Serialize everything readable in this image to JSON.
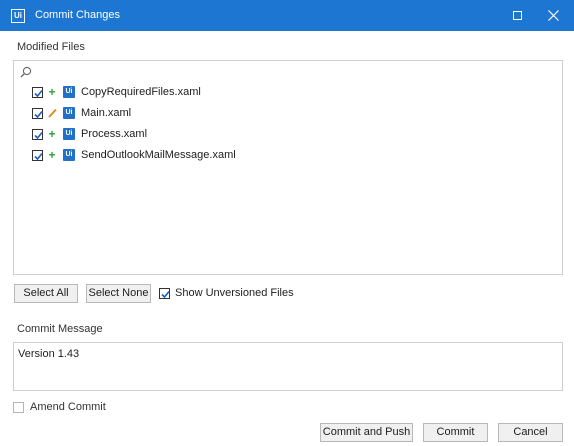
{
  "window": {
    "app_icon": "Ui",
    "title": "Commit Changes"
  },
  "modified_files": {
    "label": "Modified Files",
    "search_icon": "search-icon",
    "items": [
      {
        "checked": true,
        "status": "added",
        "status_glyph": "+",
        "badge": "Ui",
        "name": "CopyRequiredFiles.xaml"
      },
      {
        "checked": true,
        "status": "modified",
        "status_glyph": "pencil",
        "badge": "Ui",
        "name": "Main.xaml"
      },
      {
        "checked": true,
        "status": "added",
        "status_glyph": "+",
        "badge": "Ui",
        "name": "Process.xaml"
      },
      {
        "checked": true,
        "status": "added",
        "status_glyph": "+",
        "badge": "Ui",
        "name": "SendOutlookMailMessage.xaml"
      }
    ]
  },
  "actions": {
    "select_all": "Select All",
    "select_none": "Select None",
    "show_unversioned": {
      "label": "Show Unversioned Files",
      "checked": true
    }
  },
  "commit_message": {
    "label": "Commit Message",
    "value": "Version 1.43"
  },
  "amend_commit": {
    "label": "Amend Commit",
    "checked": false
  },
  "footer": {
    "commit_and_push": "Commit and Push",
    "commit": "Commit",
    "cancel": "Cancel"
  },
  "colors": {
    "titlebar": "#1d76d2",
    "added": "#2aa532",
    "modified": "#e08a1e",
    "badge": "#2270c8"
  }
}
